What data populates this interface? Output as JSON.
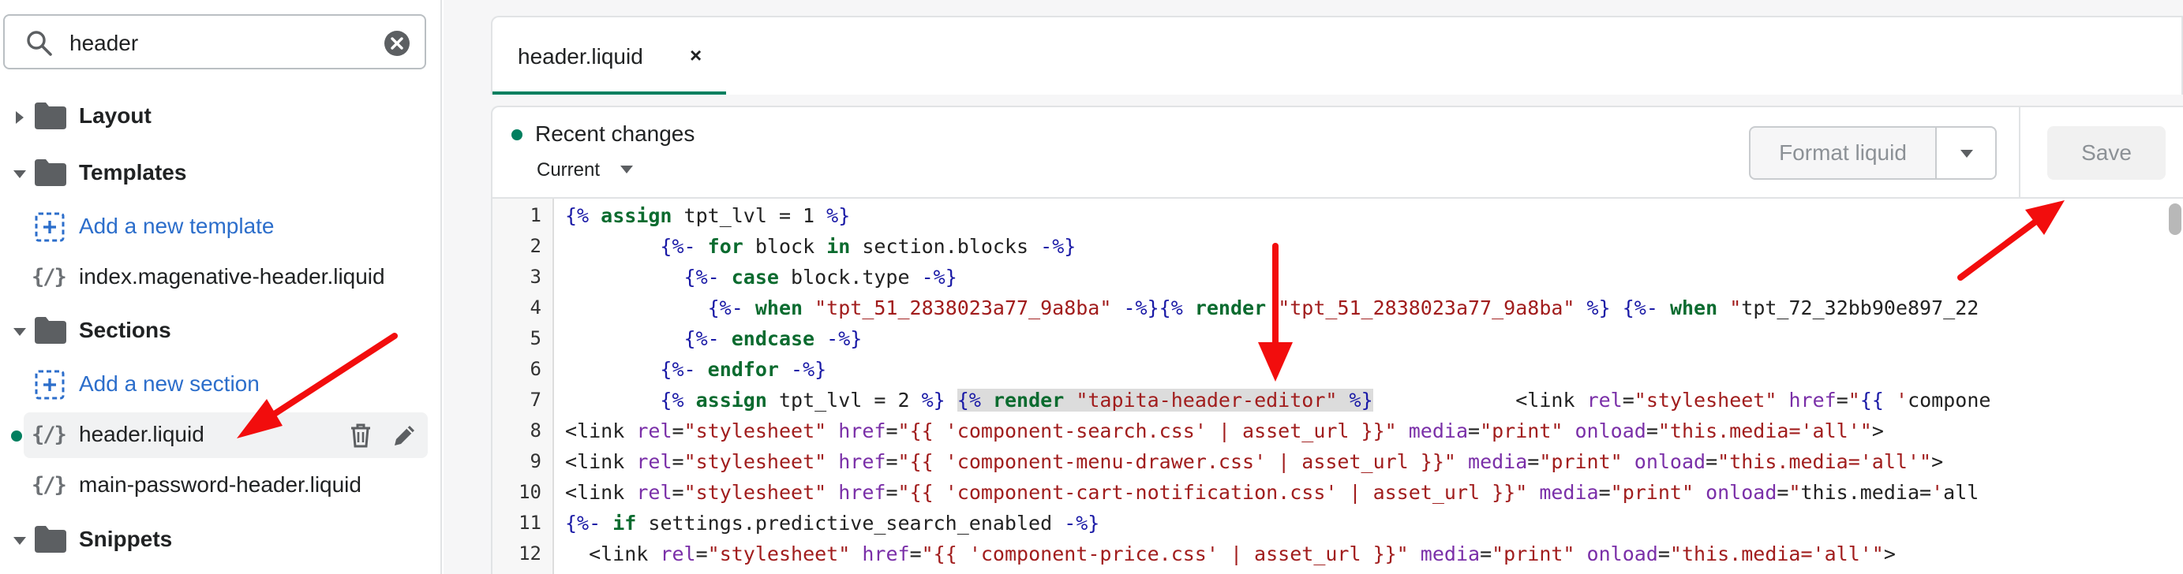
{
  "sidebar": {
    "search": {
      "value": "header"
    },
    "tree": [
      {
        "type": "folder",
        "label": "Layout",
        "expanded": false
      },
      {
        "type": "folder",
        "label": "Templates",
        "expanded": true
      },
      {
        "type": "add",
        "label": "Add a new template"
      },
      {
        "type": "file",
        "label": "index.magenative-header.liquid"
      },
      {
        "type": "folder",
        "label": "Sections",
        "expanded": true
      },
      {
        "type": "add",
        "label": "Add a new section"
      },
      {
        "type": "file",
        "label": "header.liquid",
        "selected": true,
        "modified": true
      },
      {
        "type": "file",
        "label": "main-password-header.liquid"
      },
      {
        "type": "folder",
        "label": "Snippets",
        "expanded": true
      }
    ]
  },
  "editor_tab": {
    "label": "header.liquid",
    "close": "×"
  },
  "panel": {
    "status": "Recent changes",
    "version": "Current",
    "format_button": "Format liquid",
    "save_button": "Save"
  },
  "code": {
    "line_numbers": [
      "1",
      "2",
      "3",
      "4",
      "5",
      "6",
      "7",
      "8",
      "9",
      "10",
      "11",
      "12"
    ],
    "lines": [
      "{% assign tpt_lvl = 1 %}",
      "        {%- for block in section.blocks -%}",
      "          {%- case block.type -%}",
      "            {%- when \"tpt_51_2838023a77_9a8ba\" -%}{% render \"tpt_51_2838023a77_9a8ba\" %} {%- when \"tpt_72_32bb90e897_22",
      "          {%- endcase -%}",
      "        {%- endfor -%}",
      "        {% assign tpt_lvl = 2 %} {% render \"tapita-header-editor\" %}            <link rel=\"stylesheet\" href=\"{{ 'compone",
      "<link rel=\"stylesheet\" href=\"{{ 'component-search.css' | asset_url }}\" media=\"print\" onload=\"this.media='all'\">",
      "<link rel=\"stylesheet\" href=\"{{ 'component-menu-drawer.css' | asset_url }}\" media=\"print\" onload=\"this.media='all'\">",
      "<link rel=\"stylesheet\" href=\"{{ 'component-cart-notification.css' | asset_url }}\" media=\"print\" onload=\"this.media='all",
      "{%- if settings.predictive_search_enabled -%}",
      "  <link rel=\"stylesheet\" href=\"{{ 'component-price.css' | asset_url }}\" media=\"print\" onload=\"this.media='all'\">"
    ],
    "highlighted_snippet": "{% render \"tapita-header-editor\" %}"
  },
  "colors": {
    "accent_green": "#007f5f",
    "link_blue": "#2c6ecb",
    "annotation_red": "#f20d0d"
  },
  "icons": {
    "search": "search-icon",
    "clear": "clear-circle-icon",
    "folder": "folder-icon",
    "add": "add-file-icon",
    "file": "liquid-file-icon",
    "trash": "trash-icon",
    "edit": "pencil-icon",
    "caret_right": "caret-right-icon",
    "caret_down": "caret-down-icon"
  }
}
